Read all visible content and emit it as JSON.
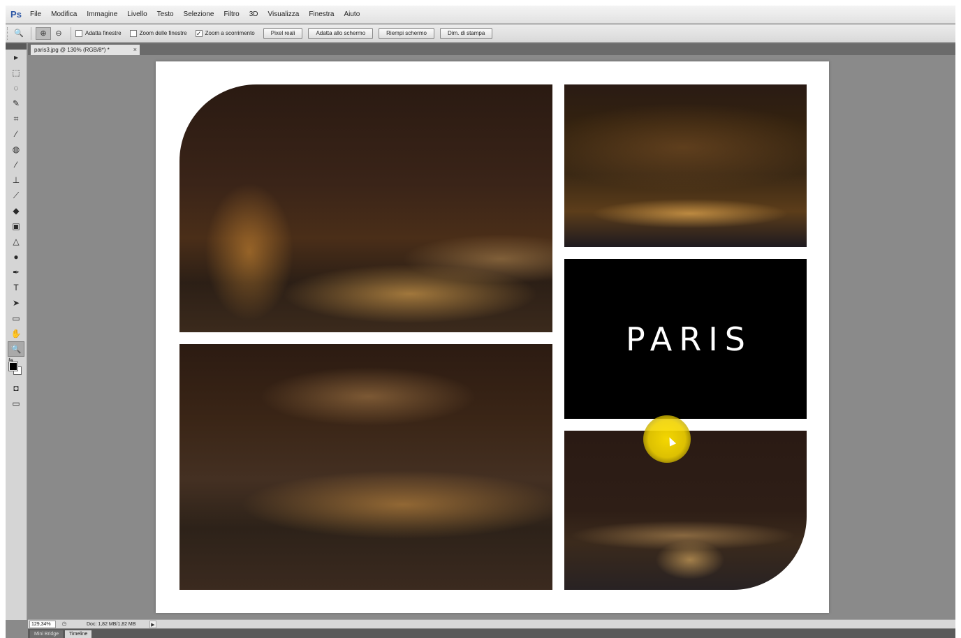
{
  "app": {
    "logo": "Ps"
  },
  "menu": [
    "File",
    "Modifica",
    "Immagine",
    "Livello",
    "Testo",
    "Selezione",
    "Filtro",
    "3D",
    "Visualizza",
    "Finestra",
    "Aiuto"
  ],
  "options": {
    "checks": [
      {
        "label": "Adatta finestre",
        "checked": false
      },
      {
        "label": "Zoom delle finestre",
        "checked": false
      },
      {
        "label": "Zoom a scorrimento",
        "checked": true
      }
    ],
    "buttons": [
      "Pixel reali",
      "Adatta allo schermo",
      "Riempi schermo",
      "Dim. di stampa"
    ]
  },
  "document": {
    "tab_title": "paris3.jpg @ 130% (RGB/8*) *",
    "close_glyph": "×",
    "poster_title": "PARIS"
  },
  "status": {
    "zoom": "129,34%",
    "doc_info": "Doc: 1,82 MB/1,82 MB"
  },
  "bottom_tabs": [
    "Mini Bridge",
    "Timeline"
  ],
  "icons": {
    "zoom_tool": "🔍",
    "zoom_in": "⊕",
    "zoom_out": "⊖",
    "check_mark": "✓",
    "arrow_right": "▶"
  },
  "tools": [
    {
      "name": "move-tool-icon",
      "glyph": "▸"
    },
    {
      "name": "marquee-tool-icon",
      "glyph": "⬚"
    },
    {
      "name": "lasso-tool-icon",
      "glyph": "◌"
    },
    {
      "name": "quick-select-tool-icon",
      "glyph": "✎"
    },
    {
      "name": "crop-tool-icon",
      "glyph": "⌗"
    },
    {
      "name": "eyedropper-tool-icon",
      "glyph": "⁄"
    },
    {
      "name": "healing-brush-tool-icon",
      "glyph": "◍"
    },
    {
      "name": "brush-tool-icon",
      "glyph": "⁄"
    },
    {
      "name": "clone-stamp-tool-icon",
      "glyph": "⊥"
    },
    {
      "name": "history-brush-tool-icon",
      "glyph": "⟋"
    },
    {
      "name": "eraser-tool-icon",
      "glyph": "◆"
    },
    {
      "name": "gradient-tool-icon",
      "glyph": "▣"
    },
    {
      "name": "blur-tool-icon",
      "glyph": "△"
    },
    {
      "name": "dodge-tool-icon",
      "glyph": "●"
    },
    {
      "name": "pen-tool-icon",
      "glyph": "✒"
    },
    {
      "name": "type-tool-icon",
      "glyph": "T"
    },
    {
      "name": "path-select-tool-icon",
      "glyph": "➤"
    },
    {
      "name": "shape-tool-icon",
      "glyph": "▭"
    },
    {
      "name": "hand-tool-icon",
      "glyph": "✋"
    },
    {
      "name": "zoom-tool-icon",
      "glyph": "🔍"
    }
  ]
}
